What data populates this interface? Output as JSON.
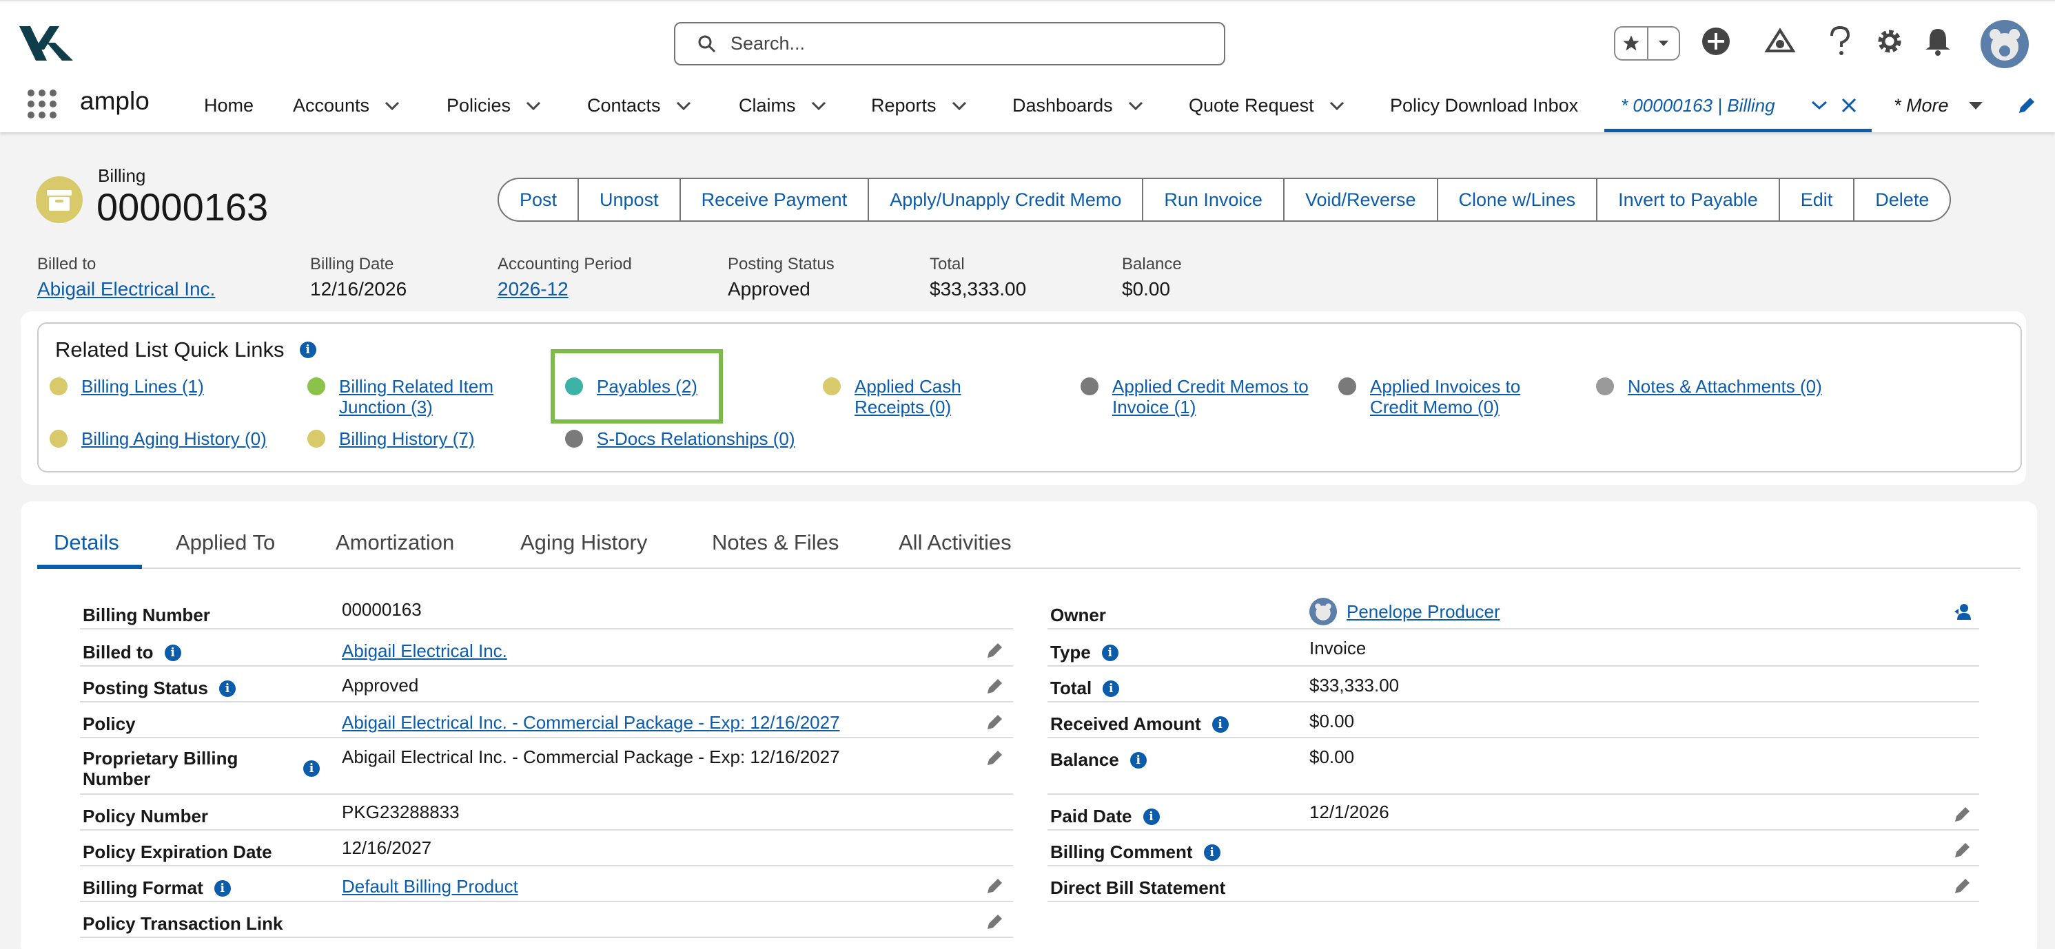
{
  "header": {
    "search_placeholder": "Search...",
    "colors": {
      "brand": "#0b5cab",
      "highlight": "#7cbb4a"
    }
  },
  "nav": {
    "app_name": "amplo",
    "items": [
      "Home",
      "Accounts",
      "Policies",
      "Contacts",
      "Claims",
      "Reports",
      "Dashboards",
      "Quote Request",
      "Policy Download Inbox"
    ],
    "active_tab": "* 00000163 | Billing",
    "more": "* More"
  },
  "record": {
    "object_type": "Billing",
    "name": "00000163",
    "actions": [
      "Post",
      "Unpost",
      "Receive Payment",
      "Apply/Unapply Credit Memo",
      "Run Invoice",
      "Void/Reverse",
      "Clone w/Lines",
      "Invert to Payable",
      "Edit",
      "Delete"
    ],
    "highlights": [
      {
        "label": "Billed to",
        "value": "Abigail Electrical Inc."
      },
      {
        "label": "Billing Date",
        "value": "12/16/2026"
      },
      {
        "label": "Accounting Period",
        "value": "2026-12"
      },
      {
        "label": "Posting Status",
        "value": "Approved"
      },
      {
        "label": "Total",
        "value": "$33,333.00"
      },
      {
        "label": "Balance",
        "value": "$0.00"
      }
    ]
  },
  "quick_links": {
    "title": "Related List Quick Links",
    "items": [
      "Billing Lines (1)",
      "Billing Related Item Junction (3)",
      "Payables (2)",
      "Applied Cash Receipts (0)",
      "Applied Credit Memos to Invoice (1)",
      "Applied Invoices to Credit Memo (0)",
      "Notes & Attachments (0)",
      "Billing Aging History (0)",
      "Billing History (7)",
      "S-Docs Relationships (0)"
    ]
  },
  "tabs": [
    "Details",
    "Applied To",
    "Amortization",
    "Aging History",
    "Notes & Files",
    "All Activities"
  ],
  "details_left": [
    {
      "label": "Billing Number",
      "value": "00000163"
    },
    {
      "label": "Billed to",
      "value": "Abigail Electrical Inc."
    },
    {
      "label": "Posting Status",
      "value": "Approved"
    },
    {
      "label": "Policy",
      "value": "Abigail Electrical Inc. - Commercial Package - Exp: 12/16/2027"
    },
    {
      "label": "Proprietary Billing Number",
      "value": "Abigail Electrical Inc. - Commercial Package - Exp: 12/16/2027"
    },
    {
      "label": "Policy Number",
      "value": "PKG23288833"
    },
    {
      "label": "Policy Expiration Date",
      "value": "12/16/2027"
    },
    {
      "label": "Billing Format",
      "value": "Default Billing Product"
    },
    {
      "label": "Policy Transaction Link",
      "value": ""
    }
  ],
  "details_right": [
    {
      "label": "Owner",
      "value": "Penelope Producer"
    },
    {
      "label": "Type",
      "value": "Invoice"
    },
    {
      "label": "Total",
      "value": "$33,333.00"
    },
    {
      "label": "Received Amount",
      "value": "$0.00"
    },
    {
      "label": "Balance",
      "value": "$0.00"
    },
    {
      "label": "Paid Date",
      "value": "12/1/2026"
    },
    {
      "label": "Billing Comment",
      "value": ""
    },
    {
      "label": "Direct Bill Statement",
      "value": ""
    }
  ]
}
